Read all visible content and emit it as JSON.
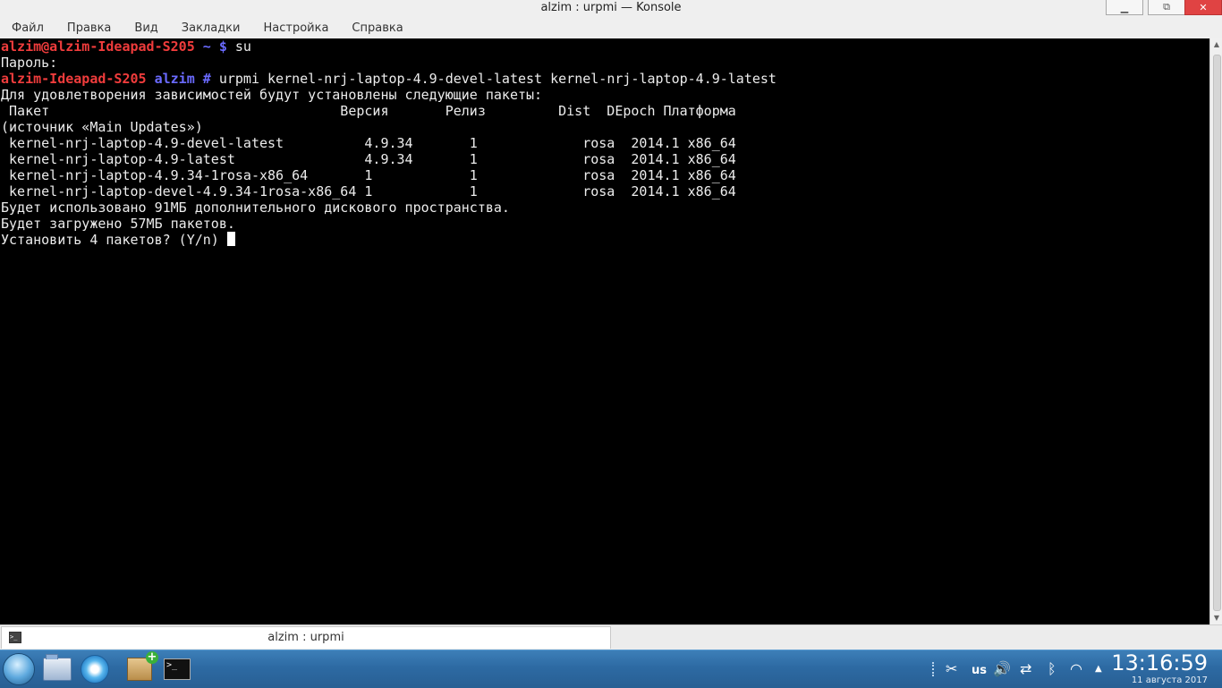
{
  "window": {
    "title": "alzim : urpmi — Konsole",
    "minimize_icon": "minimize-icon",
    "maximize_icon": "restore-icon",
    "close_icon": "close-icon",
    "minimize_glyph": "▁",
    "maximize_glyph": "⧉",
    "close_glyph": "✕"
  },
  "menu": {
    "items": [
      "Файл",
      "Правка",
      "Вид",
      "Закладки",
      "Настройка",
      "Справка"
    ]
  },
  "terminal": {
    "prompt1": {
      "user_host": "alzim@alzim-Ideapad-S205",
      "path": " ~ $",
      "command": " su"
    },
    "password_prompt": "Пароль:",
    "prompt2": {
      "host": "alzim-Ideapad-S205",
      "path": " alzim #",
      "command": " urpmi kernel-nrj-laptop-4.9-devel-latest kernel-nrj-laptop-4.9-latest"
    },
    "deps_message": "Для удовлетворения зависимостей будут установлены следующие пакеты:",
    "table_header": " Пакет                                    Версия       Релиз         Dist  DEpoch Платформа",
    "source_line": "(источник «Main Updates»)",
    "packages": [
      " kernel-nrj-laptop-4.9-devel-latest          4.9.34       1             rosa  2014.1 x86_64",
      " kernel-nrj-laptop-4.9-latest                4.9.34       1             rosa  2014.1 x86_64",
      " kernel-nrj-laptop-4.9.34-1rosa-x86_64       1            1             rosa  2014.1 x86_64",
      " kernel-nrj-laptop-devel-4.9.34-1rosa-x86_64 1            1             rosa  2014.1 x86_64"
    ],
    "disk_usage": "Будет использовано 91МБ дополнительного дискового пространства.",
    "download_size": "Будет загружено 57МБ пакетов.",
    "confirm_prompt": "Установить 4 пакетов? (Y/n) "
  },
  "tab": {
    "label": "alzim : urpmi",
    "icon": "terminal-icon"
  },
  "taskbar": {
    "launchers": [
      "rosa-menu-icon",
      "file-manager-icon",
      "browser-icon",
      "package-installer-icon",
      "konsole-icon"
    ],
    "term_glyph": ">_",
    "tray": {
      "clipboard_glyph": "✂",
      "language": "us",
      "volume_glyph": "🔊",
      "network_glyph": "⇄",
      "bluetooth_glyph": "ᛒ",
      "wifi_glyph": "◠",
      "expand_glyph": "▲"
    },
    "clock": {
      "time": "13:16:59",
      "date": "11 августа 2017"
    }
  },
  "colors": {
    "terminal_bg": "#000000",
    "prompt_red": "#f03c3c",
    "prompt_blue": "#6a6aff",
    "panel_blue": "#2d6aa3"
  }
}
